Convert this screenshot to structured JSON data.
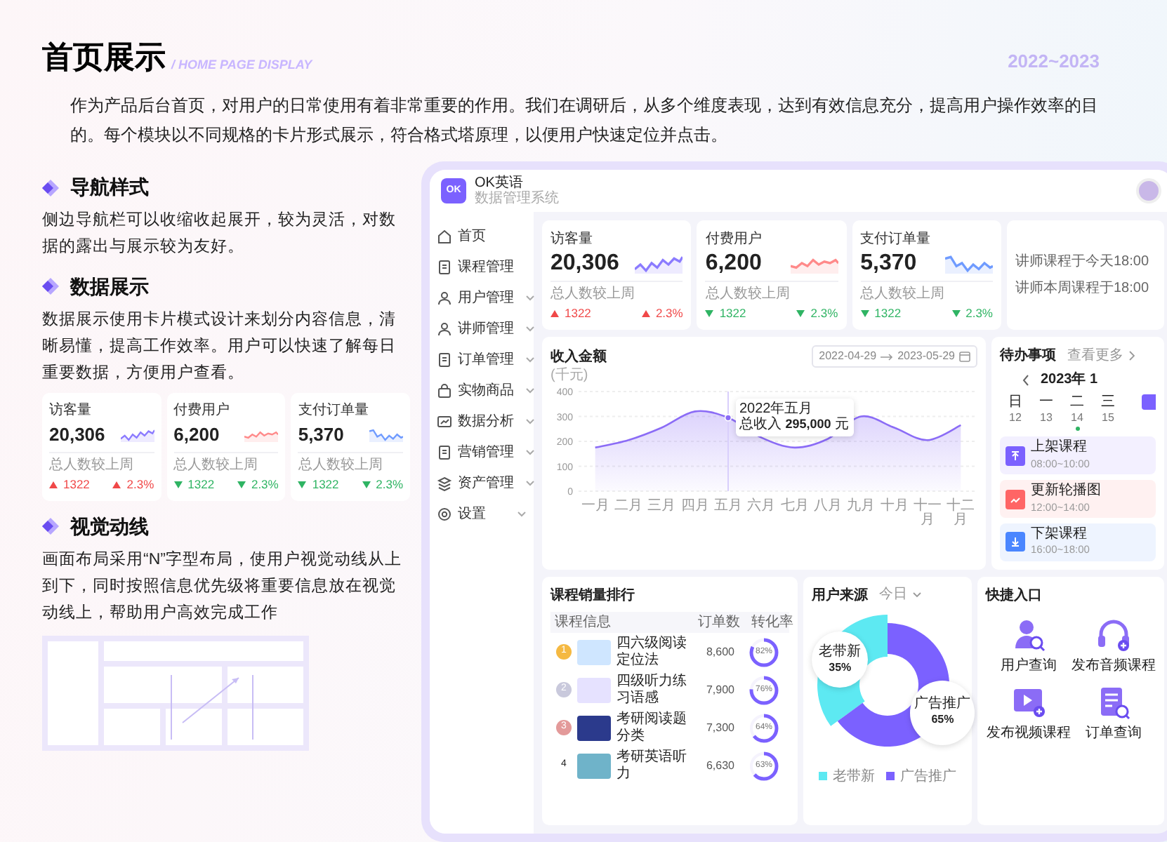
{
  "header": {
    "title": "首页展示",
    "subtitle": "/ HOME PAGE DISPLAY",
    "years": "2022~2023"
  },
  "intro": "作为产品后台首页，对用户的日常使用有着非常重要的作用。我们在调研后，从多个维度表现，达到有效信息充分，提高用户操作效率的目的。每个模块以不同规格的卡片形式展示，符合格式塔原理，以便用户快速定位并点击。",
  "sections": [
    {
      "heading": "导航样式",
      "text": "侧边导航栏可以收缩收起展开，较为灵活，对数据的露出与展示较为友好。"
    },
    {
      "heading": "数据展示",
      "text": "数据展示使用卡片模式设计来划分内容信息，清晰易懂，提高工作效率。用户可以快速了解每日重要数据，方便用户查看。",
      "stat_cards": [
        {
          "title": "访客量",
          "value": "20,306",
          "compare_label": "总人数较上周",
          "rising": true,
          "change": "1322",
          "percent": "2.3%",
          "color": "#8b7bff"
        },
        {
          "title": "付费用户",
          "value": "6,200",
          "compare_label": "总人数较上周",
          "rising": false,
          "change": "1322",
          "percent": "2.3%",
          "color": "#ff8a8a"
        },
        {
          "title": "支付订单量",
          "value": "5,370",
          "compare_label": "总人数较上周",
          "rising": false,
          "change": "1322",
          "percent": "2.3%",
          "color": "#6f9bff"
        }
      ]
    },
    {
      "heading": "视觉动线",
      "text": "画面布局采用“N”字型布局，使用户视觉动线从上到下，同时按照信息优先级将重要信息放在视觉动线上，帮助用户高效完成工作"
    }
  ],
  "dashboard": {
    "brand": {
      "logo": "OK",
      "name": "OK英语",
      "tagline": "数据管理系统"
    },
    "sidebar": {
      "items": [
        {
          "label": "首页",
          "expandable": false
        },
        {
          "label": "课程管理",
          "expandable": false
        },
        {
          "label": "用户管理",
          "expandable": true
        },
        {
          "label": "讲师管理",
          "expandable": true
        },
        {
          "label": "订单管理",
          "expandable": true
        },
        {
          "label": "实物商品",
          "expandable": true
        },
        {
          "label": "数据分析",
          "expandable": true
        },
        {
          "label": "营销管理",
          "expandable": true
        },
        {
          "label": "资产管理",
          "expandable": true
        },
        {
          "label": "设置",
          "expandable": true
        }
      ]
    },
    "stat_cards": [
      {
        "title": "访客量",
        "value": "20,306",
        "compare_label": "总人数较上周",
        "rising": true,
        "change": "1322",
        "percent": "2.3%",
        "color": "#8b7bff"
      },
      {
        "title": "付费用户",
        "value": "6,200",
        "compare_label": "总人数较上周",
        "rising": false,
        "change": "1322",
        "percent": "2.3%",
        "color": "#ff8a8a"
      },
      {
        "title": "支付订单量",
        "value": "5,370",
        "compare_label": "总人数较上周",
        "rising": false,
        "change": "1322",
        "percent": "2.3%",
        "color": "#6f9bff"
      }
    ],
    "notices": [
      "讲师课程于今天18:00",
      "讲师本周课程于18:00"
    ],
    "income": {
      "title": "收入金额",
      "date_start": "2022-04-29",
      "date_end": "2023-05-29",
      "unit": "(千元)",
      "chart_data": {
        "type": "area",
        "categories": [
          "一月",
          "二月",
          "三月",
          "四月",
          "五月",
          "六月",
          "七月",
          "八月",
          "九月",
          "十月",
          "十一月",
          "十二月"
        ],
        "values": [
          175,
          205,
          255,
          320,
          295,
          215,
          175,
          210,
          300,
          255,
          205,
          265
        ],
        "ylim": [
          0,
          400
        ],
        "yticks": [
          0,
          100,
          200,
          300,
          400
        ],
        "grid": true,
        "ref_lines": [
          {
            "axis": "x",
            "value": "五月"
          }
        ],
        "annotations": [
          {
            "x": "五月",
            "y": 295,
            "text": "2022年五月"
          },
          {
            "x": "五月",
            "y": 295,
            "text": "总收入 **295,000** 元"
          }
        ]
      }
    },
    "todo": {
      "title": "待办事项",
      "more": "查看更多",
      "month": "2023年 1",
      "weekdays": [
        "日",
        "一",
        "二",
        "三"
      ],
      "dates": [
        {
          "day": "12",
          "marked": false
        },
        {
          "day": "13",
          "marked": false
        },
        {
          "day": "14",
          "marked": true
        },
        {
          "day": "15",
          "marked": false
        }
      ],
      "events": [
        {
          "title": "上架课程",
          "time": "08:00~10:00",
          "kind": "upload",
          "color": "#7b61ff"
        },
        {
          "title": "更新轮播图",
          "time": "12:00~14:00",
          "kind": "image",
          "color": "#ff6565"
        },
        {
          "title": "下架课程",
          "time": "16:00~18:00",
          "kind": "download",
          "color": "#4a86ff"
        }
      ]
    },
    "ranking": {
      "title": "课程销量排行",
      "columns": [
        "课程信息",
        "订单数",
        "转化率"
      ],
      "rows": [
        {
          "rank": "1",
          "color": "#f5b942",
          "name": "四六级阅读定位法",
          "orders": "8,600",
          "rate": "82%"
        },
        {
          "rank": "2",
          "color": "#c9c9dc",
          "name": "四级听力练习语感",
          "orders": "7,900",
          "rate": "76%"
        },
        {
          "rank": "3",
          "color": "#e39a9a",
          "name": "考研阅读题分类",
          "orders": "7,300",
          "rate": "64%"
        },
        {
          "rank": "4",
          "name": "考研英语听力",
          "orders": "6,630",
          "rate": "63%"
        }
      ]
    },
    "user_source": {
      "title": "用户来源",
      "period": "今日",
      "chart_data": {
        "type": "donut",
        "categories": [
          "老带新",
          "广告推广"
        ],
        "values": [
          35,
          65
        ],
        "value_labels": [
          "35%",
          "65%"
        ]
      },
      "legend": [
        {
          "label": "老带新",
          "color": "#5de9f2"
        },
        {
          "label": "广告推广",
          "color": "#7b61ff"
        }
      ]
    },
    "quick": {
      "title": "快捷入口",
      "items": [
        "用户查询",
        "发布音频课程",
        "发布视频课程",
        "订单查询"
      ]
    }
  }
}
